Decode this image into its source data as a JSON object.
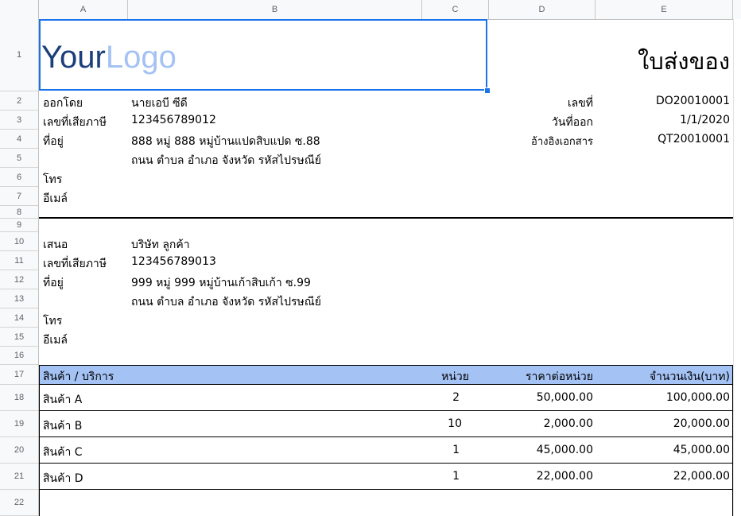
{
  "columns": [
    "A",
    "B",
    "C",
    "D",
    "E"
  ],
  "rows": [
    "1",
    "2",
    "3",
    "4",
    "5",
    "6",
    "7",
    "8",
    "9",
    "10",
    "11",
    "12",
    "13",
    "14",
    "15",
    "16",
    "17",
    "18",
    "19",
    "20",
    "21",
    "22"
  ],
  "logo": {
    "part1": "Your",
    "part2": "Logo"
  },
  "doc_title": "ใบส่งของ",
  "issuer": {
    "by_label": "ออกโดย",
    "by_value": "นายเอบี ซีดี",
    "tax_label": "เลขที่เสียภาษี",
    "tax_value": "123456789012",
    "addr_label": "ที่อยู่",
    "addr_line1": "888 หมู่ 888 หมู่บ้านแปดสิบแปด ซ.88",
    "addr_line2": "ถนน ตำบล อำเภอ จังหวัด รหัสไปรษณีย์",
    "phone_label": "โทร",
    "email_label": "อีเมล์"
  },
  "docinfo": {
    "no_label": "เลขที่",
    "no_value": "DO20010001",
    "date_label": "วันที่ออก",
    "date_value": "1/1/2020",
    "ref_label": "อ้างอิงเอกสาร",
    "ref_value": "QT20010001"
  },
  "customer": {
    "to_label": "เสนอ",
    "to_value": "บริษัท ลูกค้า",
    "tax_label": "เลขที่เสียภาษี",
    "tax_value": "123456789013",
    "addr_label": "ที่อยู่",
    "addr_line1": "999 หมู่ 999 หมู่บ้านเก้าสิบเก้า ซ.99",
    "addr_line2": "ถนน ตำบล อำเภอ จังหวัด รหัสไปรษณีย์",
    "phone_label": "โทร",
    "email_label": "อีเมล์"
  },
  "table": {
    "headers": {
      "item": "สินค้า / บริการ",
      "qty": "หน่วย",
      "price": "ราคาต่อหน่วย",
      "amount": "จำนวนเงิน(บาท)"
    },
    "rows": [
      {
        "item": "สินค้า A",
        "qty": "2",
        "price": "50,000.00",
        "amount": "100,000.00"
      },
      {
        "item": "สินค้า B",
        "qty": "10",
        "price": "2,000.00",
        "amount": "20,000.00"
      },
      {
        "item": "สินค้า C",
        "qty": "1",
        "price": "45,000.00",
        "amount": "45,000.00"
      },
      {
        "item": "สินค้า D",
        "qty": "1",
        "price": "22,000.00",
        "amount": "22,000.00"
      }
    ]
  },
  "colors": {
    "selection": "#1a73e8",
    "header_fill": "#a4c2f4",
    "logo_dark": "#1a3f7a",
    "logo_light": "#a4c2f4"
  }
}
